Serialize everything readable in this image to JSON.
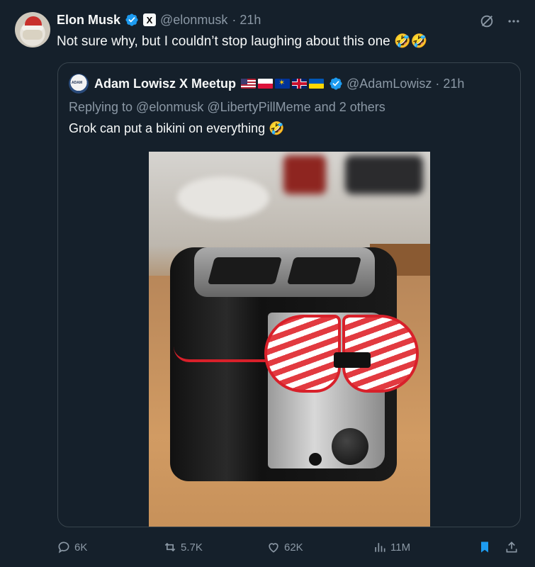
{
  "author": {
    "name": "Elon Musk",
    "badge": "X",
    "handle": "@elonmusk",
    "time": "· 21h"
  },
  "tweet": {
    "text": "Not sure why, but I couldn’t stop laughing about this one 🤣🤣"
  },
  "quote": {
    "name": "Adam Lowisz X Meetup",
    "flags": [
      "us",
      "pl",
      "eu",
      "uk",
      "ua"
    ],
    "handle": "@AdamLowisz",
    "time": "· 21h",
    "replying": "Replying to @elonmusk @LibertyPillMeme and 2 others",
    "text": "Grok can put a bikini on everything 🤣"
  },
  "actions": {
    "replies": "6K",
    "reposts": "5.7K",
    "likes": "62K",
    "views": "11M"
  },
  "colors": {
    "background": "#15202b",
    "verified": "#1d9bf0",
    "muted": "#8b98a5",
    "bookmark_active": "#1d9bf0",
    "border": "#38444d"
  },
  "icons": [
    "verified-badge-icon",
    "grok-icon",
    "more-icon",
    "reply-icon",
    "retweet-icon",
    "like-icon",
    "views-icon",
    "bookmark-icon",
    "share-icon"
  ]
}
